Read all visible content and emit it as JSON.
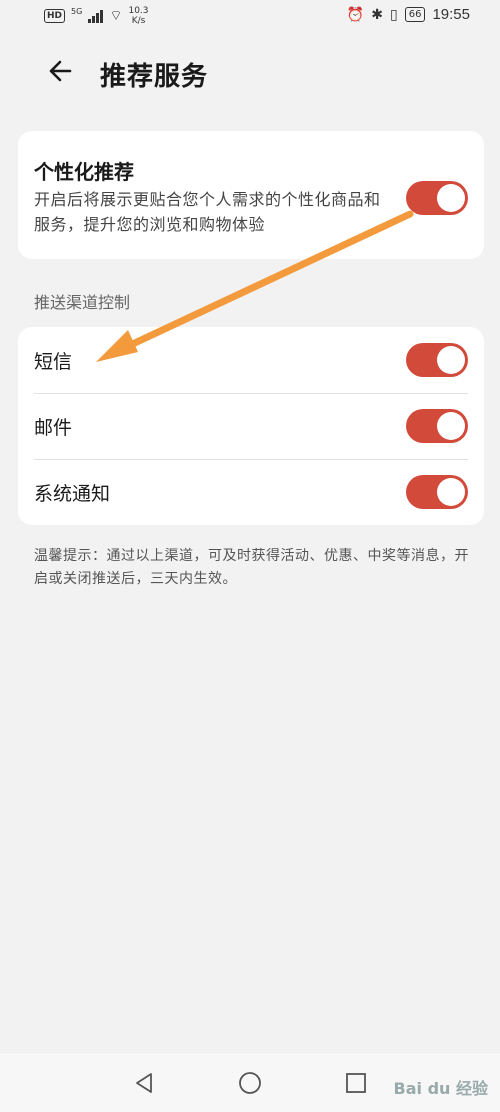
{
  "status_bar": {
    "hd": "HD",
    "network": "5G",
    "speed_value": "10.3",
    "speed_unit": "K/s",
    "battery": "66",
    "time": "19:55"
  },
  "header": {
    "title": "推荐服务"
  },
  "personalized": {
    "title": "个性化推荐",
    "description": "开启后将展示更贴合您个人需求的个性化商品和服务，提升您的浏览和购物体验",
    "enabled": true
  },
  "section_title": "推送渠道控制",
  "channels": [
    {
      "label": "短信",
      "enabled": true
    },
    {
      "label": "邮件",
      "enabled": true
    },
    {
      "label": "系统通知",
      "enabled": true
    }
  ],
  "tip": "温馨提示：通过以上渠道，可及时获得活动、优惠、中奖等消息，开启或关闭推送后，三天内生效。",
  "colors": {
    "toggle_on": "#d24a3a",
    "arrow": "#f39a3c",
    "background": "#f2f2f2"
  },
  "watermark": "Bai du 经验"
}
